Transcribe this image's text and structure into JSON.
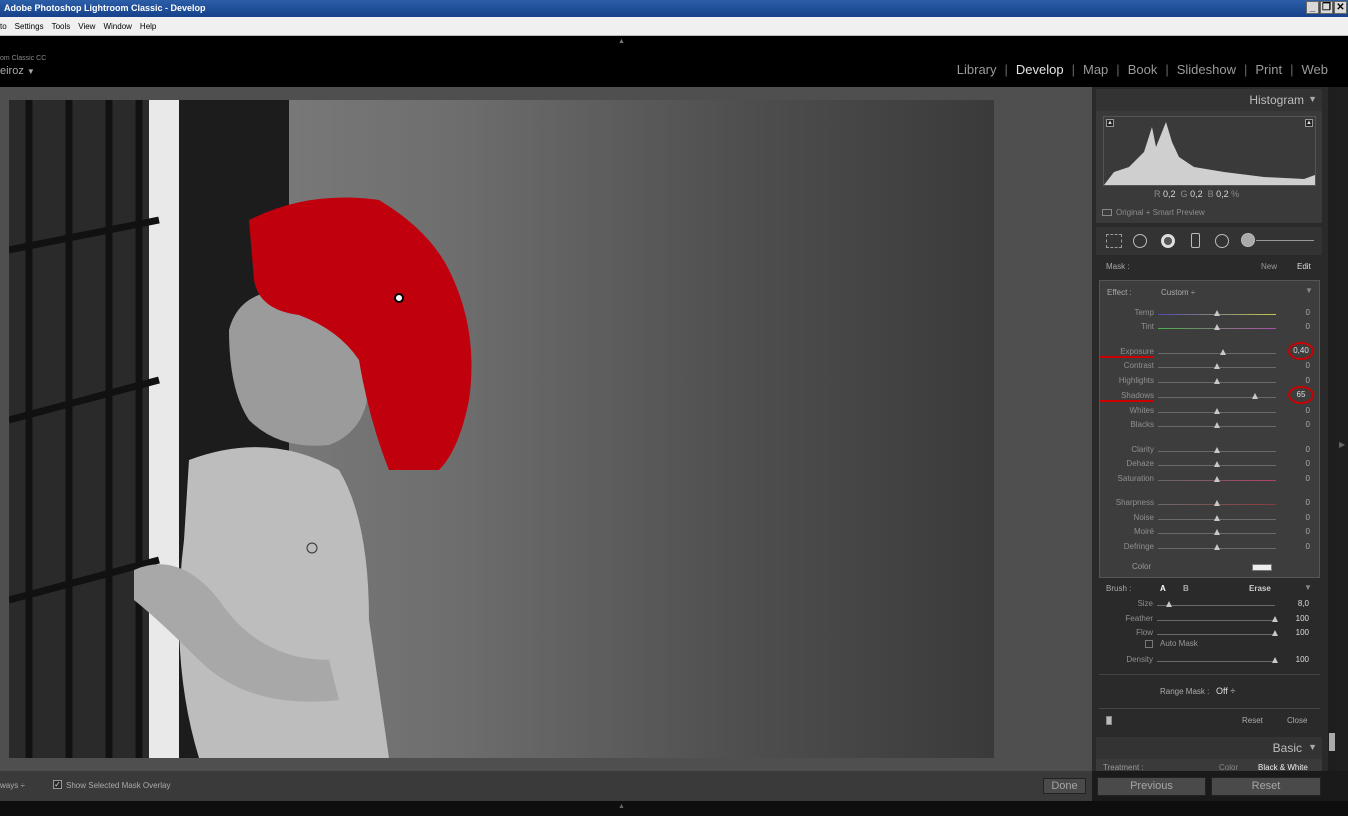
{
  "window": {
    "title": "Adobe Photoshop Lightroom Classic - Develop",
    "min": "_",
    "restore": "❐",
    "close": "✕"
  },
  "menu": [
    "to",
    "Settings",
    "Tools",
    "View",
    "Window",
    "Help"
  ],
  "identity": {
    "line1": "om Classic CC",
    "line2": "eiroz",
    "caret": "▼"
  },
  "modules": [
    {
      "label": "Library",
      "active": false
    },
    {
      "label": "Develop",
      "active": true
    },
    {
      "label": "Map",
      "active": false
    },
    {
      "label": "Book",
      "active": false
    },
    {
      "label": "Slideshow",
      "active": false
    },
    {
      "label": "Print",
      "active": false
    },
    {
      "label": "Web",
      "active": false
    }
  ],
  "histogram": {
    "title": "Histogram",
    "r_label": "R",
    "r_value": "0,2",
    "g_label": "G",
    "g_value": "0,2",
    "b_label": "B",
    "b_value": "0,2",
    "percent": "%",
    "preview": "Original + Smart Preview"
  },
  "mask": {
    "label": "Mask :",
    "new": "New",
    "edit": "Edit"
  },
  "effect": {
    "label": "Effect :",
    "preset": "Custom ÷"
  },
  "sliders": [
    {
      "label": "Temp",
      "value": "0",
      "pos": 0.5,
      "highlight": false,
      "track": "temp"
    },
    {
      "label": "Tint",
      "value": "0",
      "pos": 0.5,
      "highlight": false,
      "track": "tint"
    },
    {
      "label": "Exposure",
      "value": "0,40",
      "pos": 0.55,
      "highlight": true,
      "track": "plain"
    },
    {
      "label": "Contrast",
      "value": "0",
      "pos": 0.5,
      "highlight": false,
      "track": "plain"
    },
    {
      "label": "Highlights",
      "value": "0",
      "pos": 0.5,
      "highlight": false,
      "track": "plain"
    },
    {
      "label": "Shadows",
      "value": "65",
      "pos": 0.82,
      "highlight": true,
      "track": "plain"
    },
    {
      "label": "Whites",
      "value": "0",
      "pos": 0.5,
      "highlight": false,
      "track": "plain"
    },
    {
      "label": "Blacks",
      "value": "0",
      "pos": 0.5,
      "highlight": false,
      "track": "plain"
    },
    {
      "label": "Clarity",
      "value": "0",
      "pos": 0.5,
      "highlight": false,
      "track": "plain"
    },
    {
      "label": "Dehaze",
      "value": "0",
      "pos": 0.5,
      "highlight": false,
      "track": "plain"
    },
    {
      "label": "Saturation",
      "value": "0",
      "pos": 0.5,
      "highlight": false,
      "track": "sat"
    },
    {
      "label": "Sharpness",
      "value": "0",
      "pos": 0.5,
      "highlight": false,
      "track": "sharp"
    },
    {
      "label": "Noise",
      "value": "0",
      "pos": 0.5,
      "highlight": false,
      "track": "plain"
    },
    {
      "label": "Moiré",
      "value": "0",
      "pos": 0.5,
      "highlight": false,
      "track": "plain"
    },
    {
      "label": "Defringe",
      "value": "0",
      "pos": 0.5,
      "highlight": false,
      "track": "plain"
    }
  ],
  "color_label": "Color",
  "brush": {
    "label": "Brush :",
    "a": "A",
    "b": "B",
    "erase": "Erase"
  },
  "brush_sliders": [
    {
      "label": "Size",
      "value": "8,0",
      "pos": 0.1
    },
    {
      "label": "Feather",
      "value": "100",
      "pos": 1.0
    },
    {
      "label": "Flow",
      "value": "100",
      "pos": 1.0
    }
  ],
  "auto_mask": "Auto Mask",
  "density": {
    "label": "Density",
    "value": "100",
    "pos": 1.0
  },
  "range_mask": {
    "label": "Range Mask :",
    "value": "Off ÷"
  },
  "panel_buttons": {
    "reset": "Reset",
    "close": "Close"
  },
  "basic": {
    "title": "Basic",
    "treatment": "Treatment :",
    "color": "Color",
    "bw": "Black & White"
  },
  "footer": {
    "previous": "Previous",
    "reset": "Reset"
  },
  "toolbar": {
    "show_label": "ways ÷",
    "overlay": "Show Selected Mask Overlay",
    "done": "Done"
  },
  "overlay_color": "#c0000d"
}
